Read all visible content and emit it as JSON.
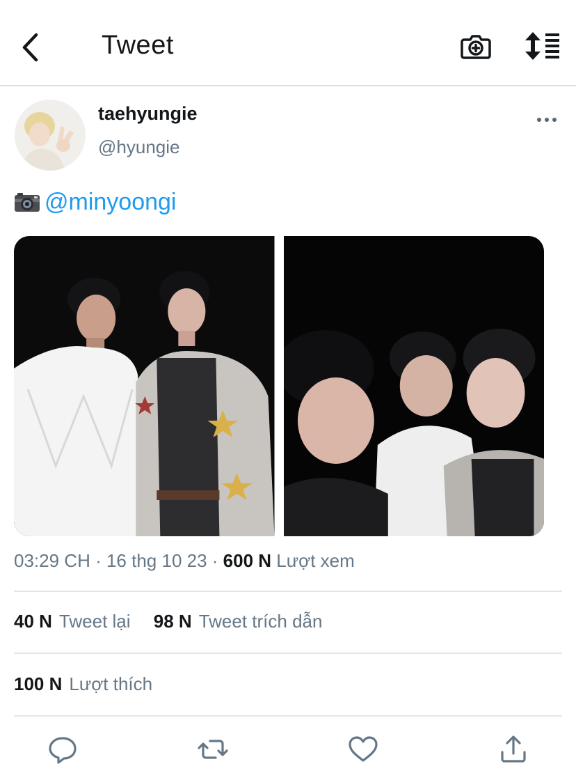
{
  "header": {
    "title": "Tweet"
  },
  "tweet": {
    "display_name": "taehyungie",
    "handle": "@hyungie",
    "text_emoji": "camera-icon",
    "mention": "@minyoongi",
    "time": "03:29 CH",
    "date": "16 thg 10 23",
    "views_count": "600 N",
    "views_label": "Lượt xem"
  },
  "stats": {
    "retweets_count": "40 N",
    "retweets_label": "Tweet lại",
    "quotes_count": "98 N",
    "quotes_label": "Tweet trích dẫn",
    "likes_count": "100 N",
    "likes_label": "Lượt thích"
  },
  "actions": [
    "reply-icon",
    "retweet-icon",
    "like-icon",
    "share-icon"
  ],
  "colors": {
    "link": "#1d9bf0",
    "secondary_text": "#657786",
    "primary_text": "#14171a"
  }
}
